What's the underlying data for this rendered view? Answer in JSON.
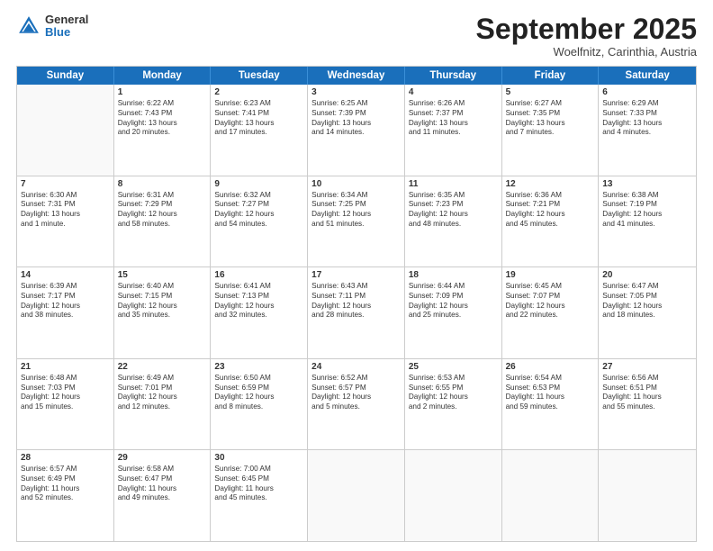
{
  "header": {
    "logo": {
      "general": "General",
      "blue": "Blue"
    },
    "title": "September 2025",
    "location": "Woelfnitz, Carinthia, Austria"
  },
  "days": [
    "Sunday",
    "Monday",
    "Tuesday",
    "Wednesday",
    "Thursday",
    "Friday",
    "Saturday"
  ],
  "weeks": [
    [
      {
        "day": "",
        "lines": []
      },
      {
        "day": "1",
        "lines": [
          "Sunrise: 6:22 AM",
          "Sunset: 7:43 PM",
          "Daylight: 13 hours",
          "and 20 minutes."
        ]
      },
      {
        "day": "2",
        "lines": [
          "Sunrise: 6:23 AM",
          "Sunset: 7:41 PM",
          "Daylight: 13 hours",
          "and 17 minutes."
        ]
      },
      {
        "day": "3",
        "lines": [
          "Sunrise: 6:25 AM",
          "Sunset: 7:39 PM",
          "Daylight: 13 hours",
          "and 14 minutes."
        ]
      },
      {
        "day": "4",
        "lines": [
          "Sunrise: 6:26 AM",
          "Sunset: 7:37 PM",
          "Daylight: 13 hours",
          "and 11 minutes."
        ]
      },
      {
        "day": "5",
        "lines": [
          "Sunrise: 6:27 AM",
          "Sunset: 7:35 PM",
          "Daylight: 13 hours",
          "and 7 minutes."
        ]
      },
      {
        "day": "6",
        "lines": [
          "Sunrise: 6:29 AM",
          "Sunset: 7:33 PM",
          "Daylight: 13 hours",
          "and 4 minutes."
        ]
      }
    ],
    [
      {
        "day": "7",
        "lines": [
          "Sunrise: 6:30 AM",
          "Sunset: 7:31 PM",
          "Daylight: 13 hours",
          "and 1 minute."
        ]
      },
      {
        "day": "8",
        "lines": [
          "Sunrise: 6:31 AM",
          "Sunset: 7:29 PM",
          "Daylight: 12 hours",
          "and 58 minutes."
        ]
      },
      {
        "day": "9",
        "lines": [
          "Sunrise: 6:32 AM",
          "Sunset: 7:27 PM",
          "Daylight: 12 hours",
          "and 54 minutes."
        ]
      },
      {
        "day": "10",
        "lines": [
          "Sunrise: 6:34 AM",
          "Sunset: 7:25 PM",
          "Daylight: 12 hours",
          "and 51 minutes."
        ]
      },
      {
        "day": "11",
        "lines": [
          "Sunrise: 6:35 AM",
          "Sunset: 7:23 PM",
          "Daylight: 12 hours",
          "and 48 minutes."
        ]
      },
      {
        "day": "12",
        "lines": [
          "Sunrise: 6:36 AM",
          "Sunset: 7:21 PM",
          "Daylight: 12 hours",
          "and 45 minutes."
        ]
      },
      {
        "day": "13",
        "lines": [
          "Sunrise: 6:38 AM",
          "Sunset: 7:19 PM",
          "Daylight: 12 hours",
          "and 41 minutes."
        ]
      }
    ],
    [
      {
        "day": "14",
        "lines": [
          "Sunrise: 6:39 AM",
          "Sunset: 7:17 PM",
          "Daylight: 12 hours",
          "and 38 minutes."
        ]
      },
      {
        "day": "15",
        "lines": [
          "Sunrise: 6:40 AM",
          "Sunset: 7:15 PM",
          "Daylight: 12 hours",
          "and 35 minutes."
        ]
      },
      {
        "day": "16",
        "lines": [
          "Sunrise: 6:41 AM",
          "Sunset: 7:13 PM",
          "Daylight: 12 hours",
          "and 32 minutes."
        ]
      },
      {
        "day": "17",
        "lines": [
          "Sunrise: 6:43 AM",
          "Sunset: 7:11 PM",
          "Daylight: 12 hours",
          "and 28 minutes."
        ]
      },
      {
        "day": "18",
        "lines": [
          "Sunrise: 6:44 AM",
          "Sunset: 7:09 PM",
          "Daylight: 12 hours",
          "and 25 minutes."
        ]
      },
      {
        "day": "19",
        "lines": [
          "Sunrise: 6:45 AM",
          "Sunset: 7:07 PM",
          "Daylight: 12 hours",
          "and 22 minutes."
        ]
      },
      {
        "day": "20",
        "lines": [
          "Sunrise: 6:47 AM",
          "Sunset: 7:05 PM",
          "Daylight: 12 hours",
          "and 18 minutes."
        ]
      }
    ],
    [
      {
        "day": "21",
        "lines": [
          "Sunrise: 6:48 AM",
          "Sunset: 7:03 PM",
          "Daylight: 12 hours",
          "and 15 minutes."
        ]
      },
      {
        "day": "22",
        "lines": [
          "Sunrise: 6:49 AM",
          "Sunset: 7:01 PM",
          "Daylight: 12 hours",
          "and 12 minutes."
        ]
      },
      {
        "day": "23",
        "lines": [
          "Sunrise: 6:50 AM",
          "Sunset: 6:59 PM",
          "Daylight: 12 hours",
          "and 8 minutes."
        ]
      },
      {
        "day": "24",
        "lines": [
          "Sunrise: 6:52 AM",
          "Sunset: 6:57 PM",
          "Daylight: 12 hours",
          "and 5 minutes."
        ]
      },
      {
        "day": "25",
        "lines": [
          "Sunrise: 6:53 AM",
          "Sunset: 6:55 PM",
          "Daylight: 12 hours",
          "and 2 minutes."
        ]
      },
      {
        "day": "26",
        "lines": [
          "Sunrise: 6:54 AM",
          "Sunset: 6:53 PM",
          "Daylight: 11 hours",
          "and 59 minutes."
        ]
      },
      {
        "day": "27",
        "lines": [
          "Sunrise: 6:56 AM",
          "Sunset: 6:51 PM",
          "Daylight: 11 hours",
          "and 55 minutes."
        ]
      }
    ],
    [
      {
        "day": "28",
        "lines": [
          "Sunrise: 6:57 AM",
          "Sunset: 6:49 PM",
          "Daylight: 11 hours",
          "and 52 minutes."
        ]
      },
      {
        "day": "29",
        "lines": [
          "Sunrise: 6:58 AM",
          "Sunset: 6:47 PM",
          "Daylight: 11 hours",
          "and 49 minutes."
        ]
      },
      {
        "day": "30",
        "lines": [
          "Sunrise: 7:00 AM",
          "Sunset: 6:45 PM",
          "Daylight: 11 hours",
          "and 45 minutes."
        ]
      },
      {
        "day": "",
        "lines": []
      },
      {
        "day": "",
        "lines": []
      },
      {
        "day": "",
        "lines": []
      },
      {
        "day": "",
        "lines": []
      }
    ]
  ]
}
